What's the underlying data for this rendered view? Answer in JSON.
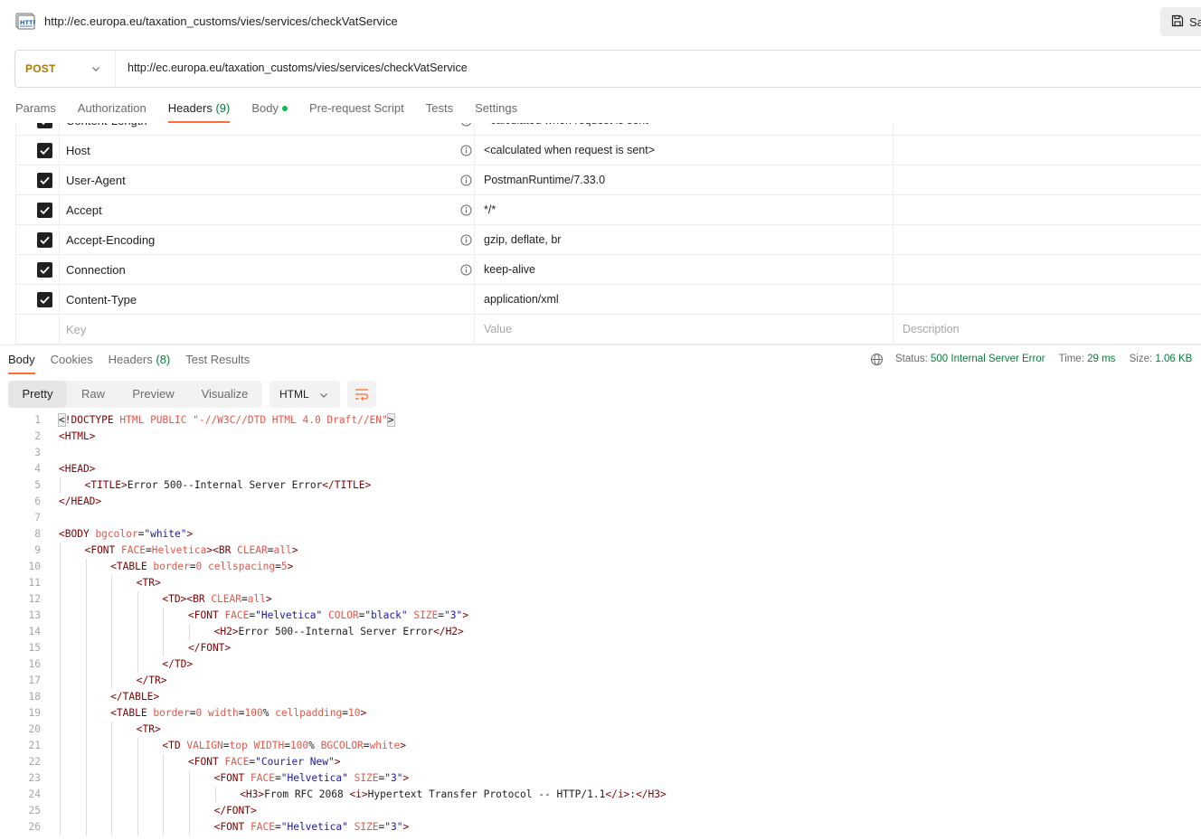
{
  "request": {
    "title": "http://ec.europa.eu/taxation_customs/vies/services/checkVatService",
    "save_label": "Sa",
    "method": "POST",
    "url": "http://ec.europa.eu/taxation_customs/vies/services/checkVatService"
  },
  "request_tabs": [
    {
      "label": "Params"
    },
    {
      "label": "Authorization"
    },
    {
      "label": "Headers",
      "count": "(9)",
      "active": true
    },
    {
      "label": "Body",
      "has_dot": true
    },
    {
      "label": "Pre-request Script"
    },
    {
      "label": "Tests"
    },
    {
      "label": "Settings"
    }
  ],
  "headers_table": {
    "partial_row": {
      "key": "Content-Length",
      "value": "<calculated when request is sent>"
    },
    "rows": [
      {
        "key": "Host",
        "value": "<calculated when request is sent>",
        "info": true
      },
      {
        "key": "User-Agent",
        "value": "PostmanRuntime/7.33.0",
        "info": true
      },
      {
        "key": "Accept",
        "value": "*/*",
        "info": true
      },
      {
        "key": "Accept-Encoding",
        "value": "gzip, deflate, br",
        "info": true
      },
      {
        "key": "Connection",
        "value": "keep-alive",
        "info": true
      },
      {
        "key": "Content-Type",
        "value": "application/xml",
        "info": false
      }
    ],
    "placeholders": {
      "key": "Key",
      "value": "Value",
      "description": "Description"
    }
  },
  "response": {
    "tabs": [
      {
        "label": "Body",
        "active": true
      },
      {
        "label": "Cookies"
      },
      {
        "label": "Headers",
        "count": "(8)"
      },
      {
        "label": "Test Results"
      }
    ],
    "status_label": "Status:",
    "status_value": "500 Internal Server Error",
    "time_label": "Time:",
    "time_value": "29 ms",
    "size_label": "Size:",
    "size_value": "1.06 KB",
    "view_modes": [
      "Pretty",
      "Raw",
      "Preview",
      "Visualize"
    ],
    "active_view": "Pretty",
    "format": "HTML"
  },
  "code_lines": [
    {
      "n": "1",
      "indent": 0,
      "tokens": [
        [
          "b",
          "<"
        ],
        [
          "tag",
          "!DOCTYPE"
        ],
        [
          "t",
          " "
        ],
        [
          "attr",
          "HTML PUBLIC"
        ],
        [
          "t",
          " "
        ],
        [
          "attr",
          "\"-//W3C//DTD HTML 4.0 Draft//EN\""
        ],
        [
          "b",
          ">"
        ]
      ]
    },
    {
      "n": "2",
      "indent": 0,
      "tokens": [
        [
          "tag",
          "<HTML>"
        ]
      ]
    },
    {
      "n": "3",
      "indent": 0,
      "tokens": []
    },
    {
      "n": "4",
      "indent": 0,
      "tokens": [
        [
          "tag",
          "<HEAD>"
        ]
      ]
    },
    {
      "n": "5",
      "indent": 1,
      "tokens": [
        [
          "tag",
          "<TITLE>"
        ],
        [
          "t",
          "Error 500--Internal Server Error"
        ],
        [
          "tag",
          "</TITLE>"
        ]
      ]
    },
    {
      "n": "6",
      "indent": 0,
      "tokens": [
        [
          "tag",
          "</HEAD>"
        ]
      ]
    },
    {
      "n": "7",
      "indent": 0,
      "tokens": []
    },
    {
      "n": "8",
      "indent": 0,
      "tokens": [
        [
          "tag",
          "<BODY"
        ],
        [
          "t",
          " "
        ],
        [
          "attr",
          "bgcolor"
        ],
        [
          "t",
          "="
        ],
        [
          "val",
          "\"white\""
        ],
        [
          "tag",
          ">"
        ]
      ]
    },
    {
      "n": "9",
      "indent": 1,
      "tokens": [
        [
          "tag",
          "<FONT"
        ],
        [
          "t",
          " "
        ],
        [
          "attr",
          "FACE"
        ],
        [
          "t",
          "="
        ],
        [
          "attr",
          "Helvetica"
        ],
        [
          "tag",
          ">"
        ],
        [
          "tag",
          "<BR"
        ],
        [
          "t",
          " "
        ],
        [
          "attr",
          "CLEAR"
        ],
        [
          "t",
          "="
        ],
        [
          "attr",
          "all"
        ],
        [
          "tag",
          ">"
        ]
      ]
    },
    {
      "n": "10",
      "indent": 2,
      "tokens": [
        [
          "tag",
          "<TABLE"
        ],
        [
          "t",
          " "
        ],
        [
          "attr",
          "border"
        ],
        [
          "t",
          "="
        ],
        [
          "attr",
          "0"
        ],
        [
          "t",
          " "
        ],
        [
          "attr",
          "cellspacing"
        ],
        [
          "t",
          "="
        ],
        [
          "attr",
          "5"
        ],
        [
          "tag",
          ">"
        ]
      ]
    },
    {
      "n": "11",
      "indent": 3,
      "tokens": [
        [
          "tag",
          "<TR>"
        ]
      ]
    },
    {
      "n": "12",
      "indent": 4,
      "tokens": [
        [
          "tag",
          "<TD>"
        ],
        [
          "tag",
          "<BR"
        ],
        [
          "t",
          " "
        ],
        [
          "attr",
          "CLEAR"
        ],
        [
          "t",
          "="
        ],
        [
          "attr",
          "all"
        ],
        [
          "tag",
          ">"
        ]
      ]
    },
    {
      "n": "13",
      "indent": 5,
      "tokens": [
        [
          "tag",
          "<FONT"
        ],
        [
          "t",
          " "
        ],
        [
          "attr",
          "FACE"
        ],
        [
          "t",
          "="
        ],
        [
          "val",
          "\"Helvetica\""
        ],
        [
          "t",
          " "
        ],
        [
          "attr",
          "COLOR"
        ],
        [
          "t",
          "="
        ],
        [
          "val",
          "\"black\""
        ],
        [
          "t",
          " "
        ],
        [
          "attr",
          "SIZE"
        ],
        [
          "t",
          "="
        ],
        [
          "val",
          "\"3\""
        ],
        [
          "tag",
          ">"
        ]
      ]
    },
    {
      "n": "14",
      "indent": 6,
      "tokens": [
        [
          "tag",
          "<H2>"
        ],
        [
          "t",
          "Error 500--Internal Server Error"
        ],
        [
          "tag",
          "</H2>"
        ]
      ]
    },
    {
      "n": "15",
      "indent": 5,
      "tokens": [
        [
          "tag",
          "</FONT>"
        ]
      ]
    },
    {
      "n": "16",
      "indent": 4,
      "tokens": [
        [
          "tag",
          "</TD>"
        ]
      ]
    },
    {
      "n": "17",
      "indent": 3,
      "tokens": [
        [
          "tag",
          "</TR>"
        ]
      ]
    },
    {
      "n": "18",
      "indent": 2,
      "tokens": [
        [
          "tag",
          "</TABLE>"
        ]
      ]
    },
    {
      "n": "19",
      "indent": 2,
      "tokens": [
        [
          "tag",
          "<TABLE"
        ],
        [
          "t",
          " "
        ],
        [
          "attr",
          "border"
        ],
        [
          "t",
          "="
        ],
        [
          "attr",
          "0"
        ],
        [
          "t",
          " "
        ],
        [
          "attr",
          "width"
        ],
        [
          "t",
          "="
        ],
        [
          "attr",
          "100"
        ],
        [
          "t",
          "% "
        ],
        [
          "attr",
          "cellpadding"
        ],
        [
          "t",
          "="
        ],
        [
          "attr",
          "10"
        ],
        [
          "tag",
          ">"
        ]
      ]
    },
    {
      "n": "20",
      "indent": 3,
      "tokens": [
        [
          "tag",
          "<TR>"
        ]
      ]
    },
    {
      "n": "21",
      "indent": 4,
      "tokens": [
        [
          "tag",
          "<TD"
        ],
        [
          "t",
          " "
        ],
        [
          "attr",
          "VALIGN"
        ],
        [
          "t",
          "="
        ],
        [
          "attr",
          "top"
        ],
        [
          "t",
          " "
        ],
        [
          "attr",
          "WIDTH"
        ],
        [
          "t",
          "="
        ],
        [
          "attr",
          "100"
        ],
        [
          "t",
          "% "
        ],
        [
          "attr",
          "BGCOLOR"
        ],
        [
          "t",
          "="
        ],
        [
          "attr",
          "white"
        ],
        [
          "tag",
          ">"
        ]
      ]
    },
    {
      "n": "22",
      "indent": 5,
      "tokens": [
        [
          "tag",
          "<FONT"
        ],
        [
          "t",
          " "
        ],
        [
          "attr",
          "FACE"
        ],
        [
          "t",
          "="
        ],
        [
          "val",
          "\"Courier New\""
        ],
        [
          "tag",
          ">"
        ]
      ]
    },
    {
      "n": "23",
      "indent": 6,
      "tokens": [
        [
          "tag",
          "<FONT"
        ],
        [
          "t",
          " "
        ],
        [
          "attr",
          "FACE"
        ],
        [
          "t",
          "="
        ],
        [
          "val",
          "\"Helvetica\""
        ],
        [
          "t",
          " "
        ],
        [
          "attr",
          "SIZE"
        ],
        [
          "t",
          "="
        ],
        [
          "val",
          "\"3\""
        ],
        [
          "tag",
          ">"
        ]
      ]
    },
    {
      "n": "24",
      "indent": 7,
      "tokens": [
        [
          "tag",
          "<H3>"
        ],
        [
          "t",
          "From RFC 2068 "
        ],
        [
          "tag",
          "<i>"
        ],
        [
          "t",
          "Hypertext Transfer Protocol -- HTTP/1.1"
        ],
        [
          "tag",
          "</i>"
        ],
        [
          "t",
          ":"
        ],
        [
          "tag",
          "</H3>"
        ]
      ]
    },
    {
      "n": "25",
      "indent": 6,
      "tokens": [
        [
          "tag",
          "</FONT>"
        ]
      ]
    },
    {
      "n": "26",
      "indent": 6,
      "tokens": [
        [
          "tag",
          "<FONT"
        ],
        [
          "t",
          " "
        ],
        [
          "attr",
          "FACE"
        ],
        [
          "t",
          "="
        ],
        [
          "val",
          "\"Helvetica\""
        ],
        [
          "t",
          " "
        ],
        [
          "attr",
          "SIZE"
        ],
        [
          "t",
          "="
        ],
        [
          "val",
          "\"3\""
        ],
        [
          "tag",
          ">"
        ]
      ]
    }
  ],
  "colors": {
    "accent": "#ff6c37",
    "method": "#ad7a03",
    "status_ok_text": "#0d7a3a",
    "body_dot": "#0cbb52"
  }
}
